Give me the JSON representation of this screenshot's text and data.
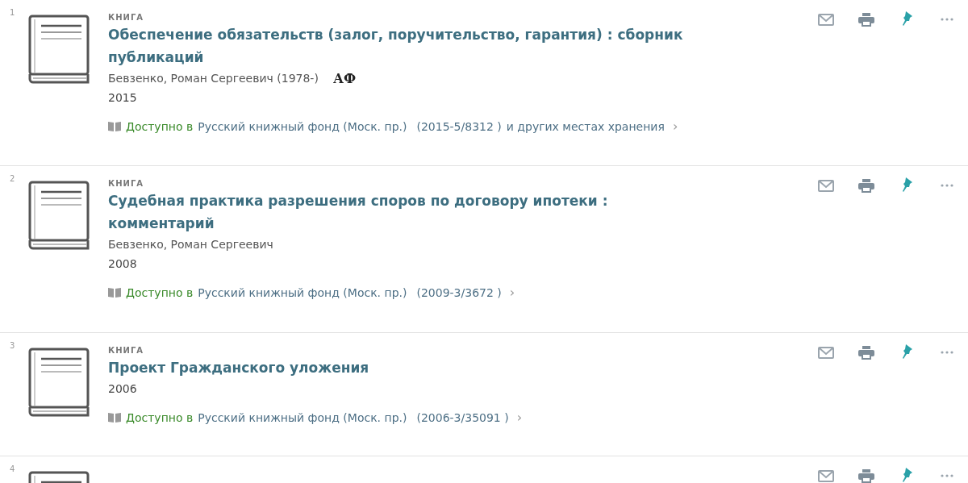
{
  "results": [
    {
      "number": "1",
      "type": "КНИГА",
      "title": "Обеспечение обязательств (залог, поручительство, гарантия) : сборник публикаций",
      "author": "Бевзенко, Роман Сергеевич (1978-)",
      "badge": "АФ",
      "year": "2015",
      "availability": {
        "status": "Доступно в",
        "location": "Русский книжный фонд (Моск. пр.)",
        "call_number": "(2015-5/8312 )",
        "more": "и других местах хранения",
        "arrow": "›"
      }
    },
    {
      "number": "2",
      "type": "КНИГА",
      "title": "Судебная практика разрешения споров по договору ипотеки : комментарий",
      "author": "Бевзенко, Роман Сергеевич",
      "year": "2008",
      "availability": {
        "status": "Доступно в",
        "location": "Русский книжный фонд (Моск. пр.)",
        "call_number": "(2009-3/3672 )",
        "arrow": "›"
      }
    },
    {
      "number": "3",
      "type": "КНИГА",
      "title": "Проект Гражданского уложения",
      "year": "2006",
      "availability": {
        "status": "Доступно в",
        "location": "Русский книжный фонд (Моск. пр.)",
        "call_number": "(2006-3/35091 )",
        "arrow": "›"
      }
    },
    {
      "number": "4"
    }
  ]
}
